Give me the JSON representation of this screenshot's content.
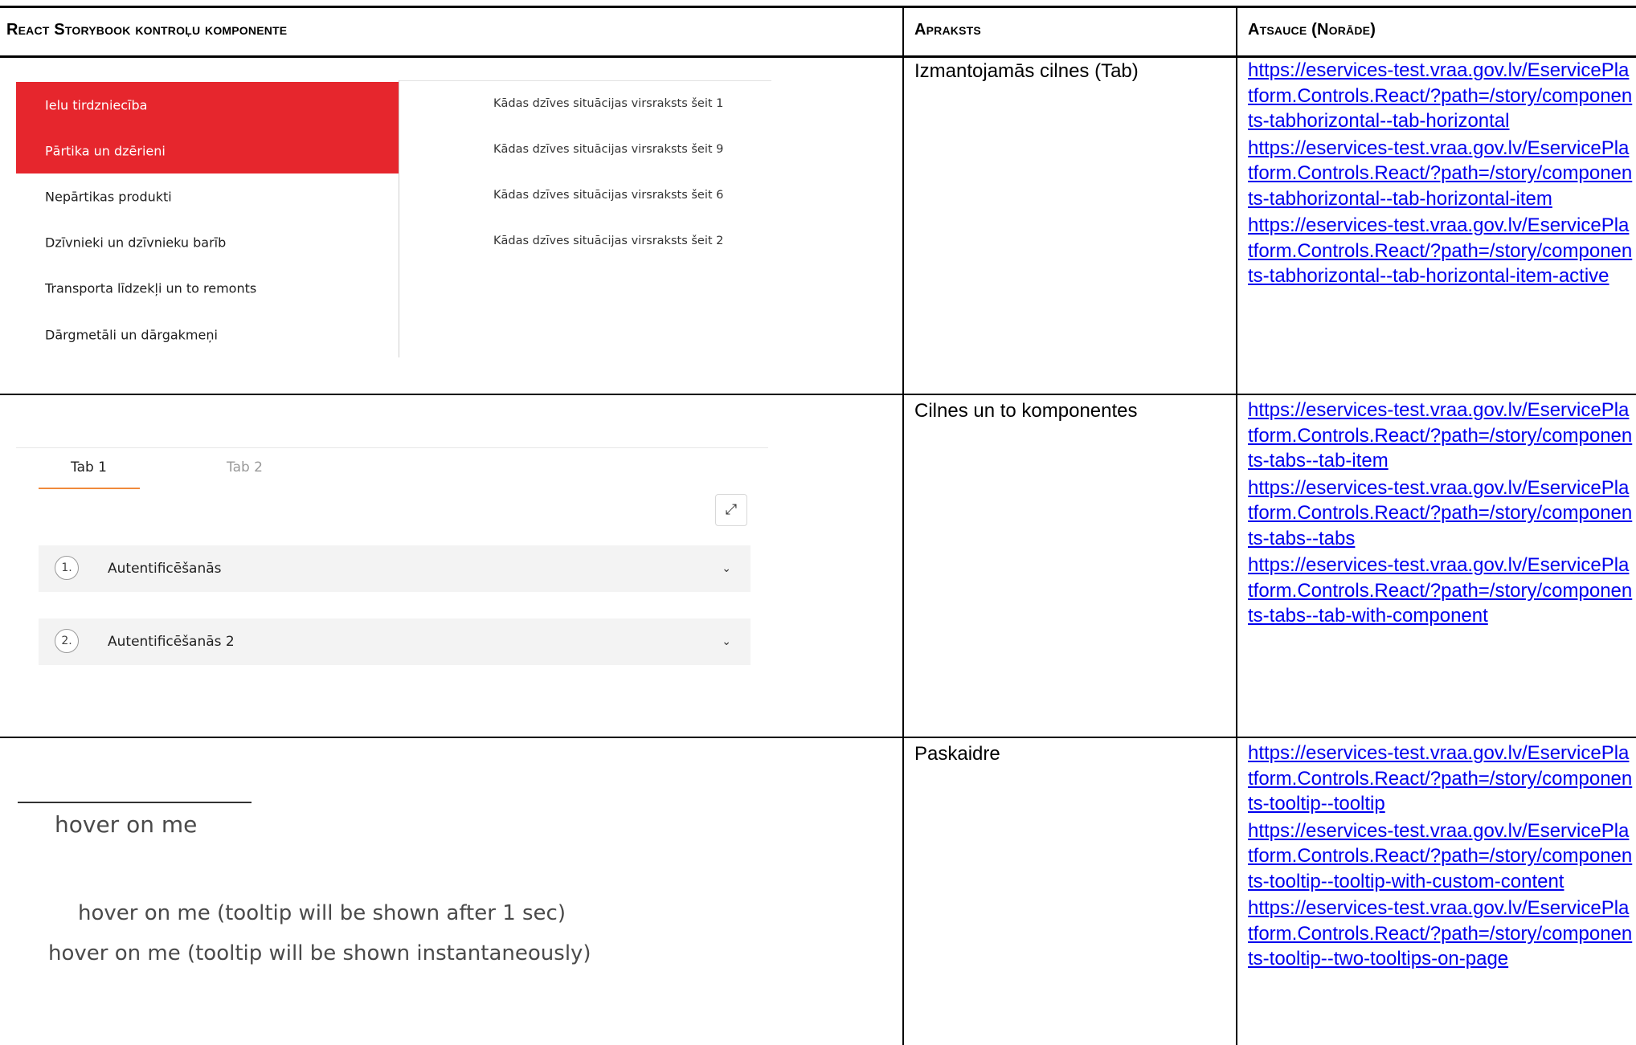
{
  "header": {
    "col1": "React Storybook kontroļu komponente",
    "col2": "Apraksts",
    "col3": "Atsauce (Norāde)"
  },
  "rows": [
    {
      "description": "Izmantojamās cilnes (Tab)",
      "links": [
        "https://eservices-test.vraa.gov.lv/EservicePlatform.Controls.React/?path=/story/components-tabhorizontal--tab-horizontal",
        "https://eservices-test.vraa.gov.lv/EservicePlatform.Controls.React/?path=/story/components-tabhorizontal--tab-horizontal-item",
        "https://eservices-test.vraa.gov.lv/EservicePlatform.Controls.React/?path=/story/components-tabhorizontal--tab-horizontal-item-active"
      ],
      "preview": {
        "left_items": [
          "Ielu tirdzniecība",
          "Pārtika un dzērieni",
          "Nepārtikas produkti",
          "Dzīvnieki un dzīvnieku barīb",
          "Transporta līdzekļi un to remonts",
          "Dārgmetāli un dārgakmeņi"
        ],
        "right_items": [
          "Kādas dzīves situācijas virsraksts šeit 1",
          "Kādas dzīves situācijas virsraksts šeit 9",
          "Kādas dzīves situācijas virsraksts šeit 6",
          "Kādas dzīves situācijas virsraksts šeit 2"
        ]
      }
    },
    {
      "description": "Cilnes un to komponentes",
      "links": [
        "https://eservices-test.vraa.gov.lv/EservicePlatform.Controls.React/?path=/story/components-tabs--tab-item",
        "https://eservices-test.vraa.gov.lv/EservicePlatform.Controls.React/?path=/story/components-tabs--tabs",
        "https://eservices-test.vraa.gov.lv/EservicePlatform.Controls.React/?path=/story/components-tabs--tab-with-component"
      ],
      "preview": {
        "tabs": [
          "Tab 1",
          "Tab 2"
        ],
        "accordion": [
          {
            "num": "1.",
            "label": "Autentificēšanās"
          },
          {
            "num": "2.",
            "label": "Autentificēšanās 2"
          }
        ],
        "expand_icon": "expand-icon",
        "chevron_icon": "chevron-down-icon"
      }
    },
    {
      "description": "Paskaidre",
      "links": [
        "https://eservices-test.vraa.gov.lv/EservicePlatform.Controls.React/?path=/story/components-tooltip--tooltip",
        "https://eservices-test.vraa.gov.lv/EservicePlatform.Controls.React/?path=/story/components-tooltip--tooltip-with-custom-content",
        "https://eservices-test.vraa.gov.lv/EservicePlatform.Controls.React/?path=/story/components-tooltip--two-tooltips-on-page"
      ],
      "preview": {
        "texts": [
          "hover on me",
          "hover on me (tooltip will be shown after 1 sec)",
          "hover on me (tooltip will be shown instantaneously)"
        ]
      }
    }
  ],
  "colors": {
    "active_tab": "#e6262d",
    "tab_underline": "#f08a3c",
    "link": "#0000ee"
  }
}
